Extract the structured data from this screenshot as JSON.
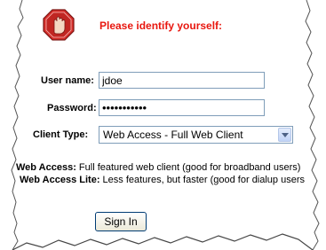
{
  "heading": "Please identify yourself:",
  "username": {
    "label": "User name:",
    "value": "jdoe"
  },
  "password": {
    "label": "Password:",
    "value": "•••••••••••"
  },
  "client_type": {
    "label": "Client Type:",
    "selected": "Web Access - Full Web Client"
  },
  "descriptions": [
    {
      "term": "Web Access:",
      "text": " Full featured web client (good for broadband users)"
    },
    {
      "term": "Web Access Lite:",
      "text": " Less features, but faster (good for dialup users"
    }
  ],
  "sign_in_label": "Sign In",
  "colors": {
    "heading": "#e8170f",
    "stop_sign": "#d8302c",
    "input_border": "#7f9db9"
  },
  "icons": {
    "stop": "stop-hand-icon",
    "dropdown": "chevron-down-icon"
  }
}
